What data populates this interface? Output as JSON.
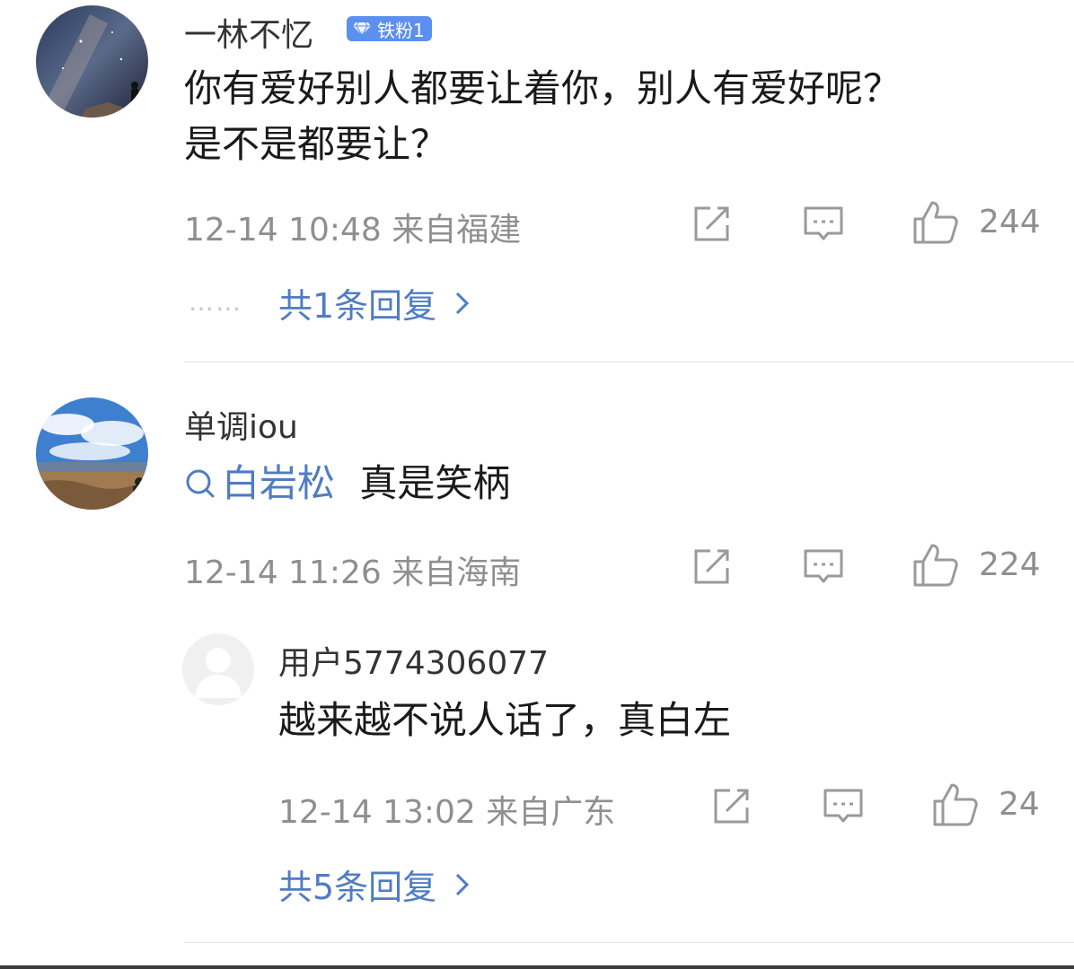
{
  "comments": [
    {
      "user": "一林不忆",
      "badge": "铁粉1",
      "text_lines": [
        "你有爱好别人都要让着你，别人有爱好呢？",
        "是不是都要让？"
      ],
      "time": "12-14 10:48",
      "location": "来自福建",
      "likes": "244",
      "dots": "……",
      "replies_label": "共1条回复"
    },
    {
      "user": "单调iou",
      "topic": "白岩松",
      "text": "真是笑柄",
      "time": "12-14 11:26",
      "location": "来自海南",
      "likes": "224",
      "reply": {
        "user": "用户5774306077",
        "text": "越来越不说人话了，真白左",
        "time": "12-14 13:02",
        "location": "来自广东",
        "likes": "24"
      },
      "replies_label": "共5条回复"
    }
  ],
  "colors": {
    "link": "#4f7cc4",
    "badge_bg": "#5b8ff0",
    "meta": "#8f8f8f",
    "divider": "#e4e4e4"
  },
  "icons": [
    "share-icon",
    "comment-icon",
    "like-icon",
    "chevron-right-icon",
    "search-icon",
    "diamond-icon"
  ]
}
